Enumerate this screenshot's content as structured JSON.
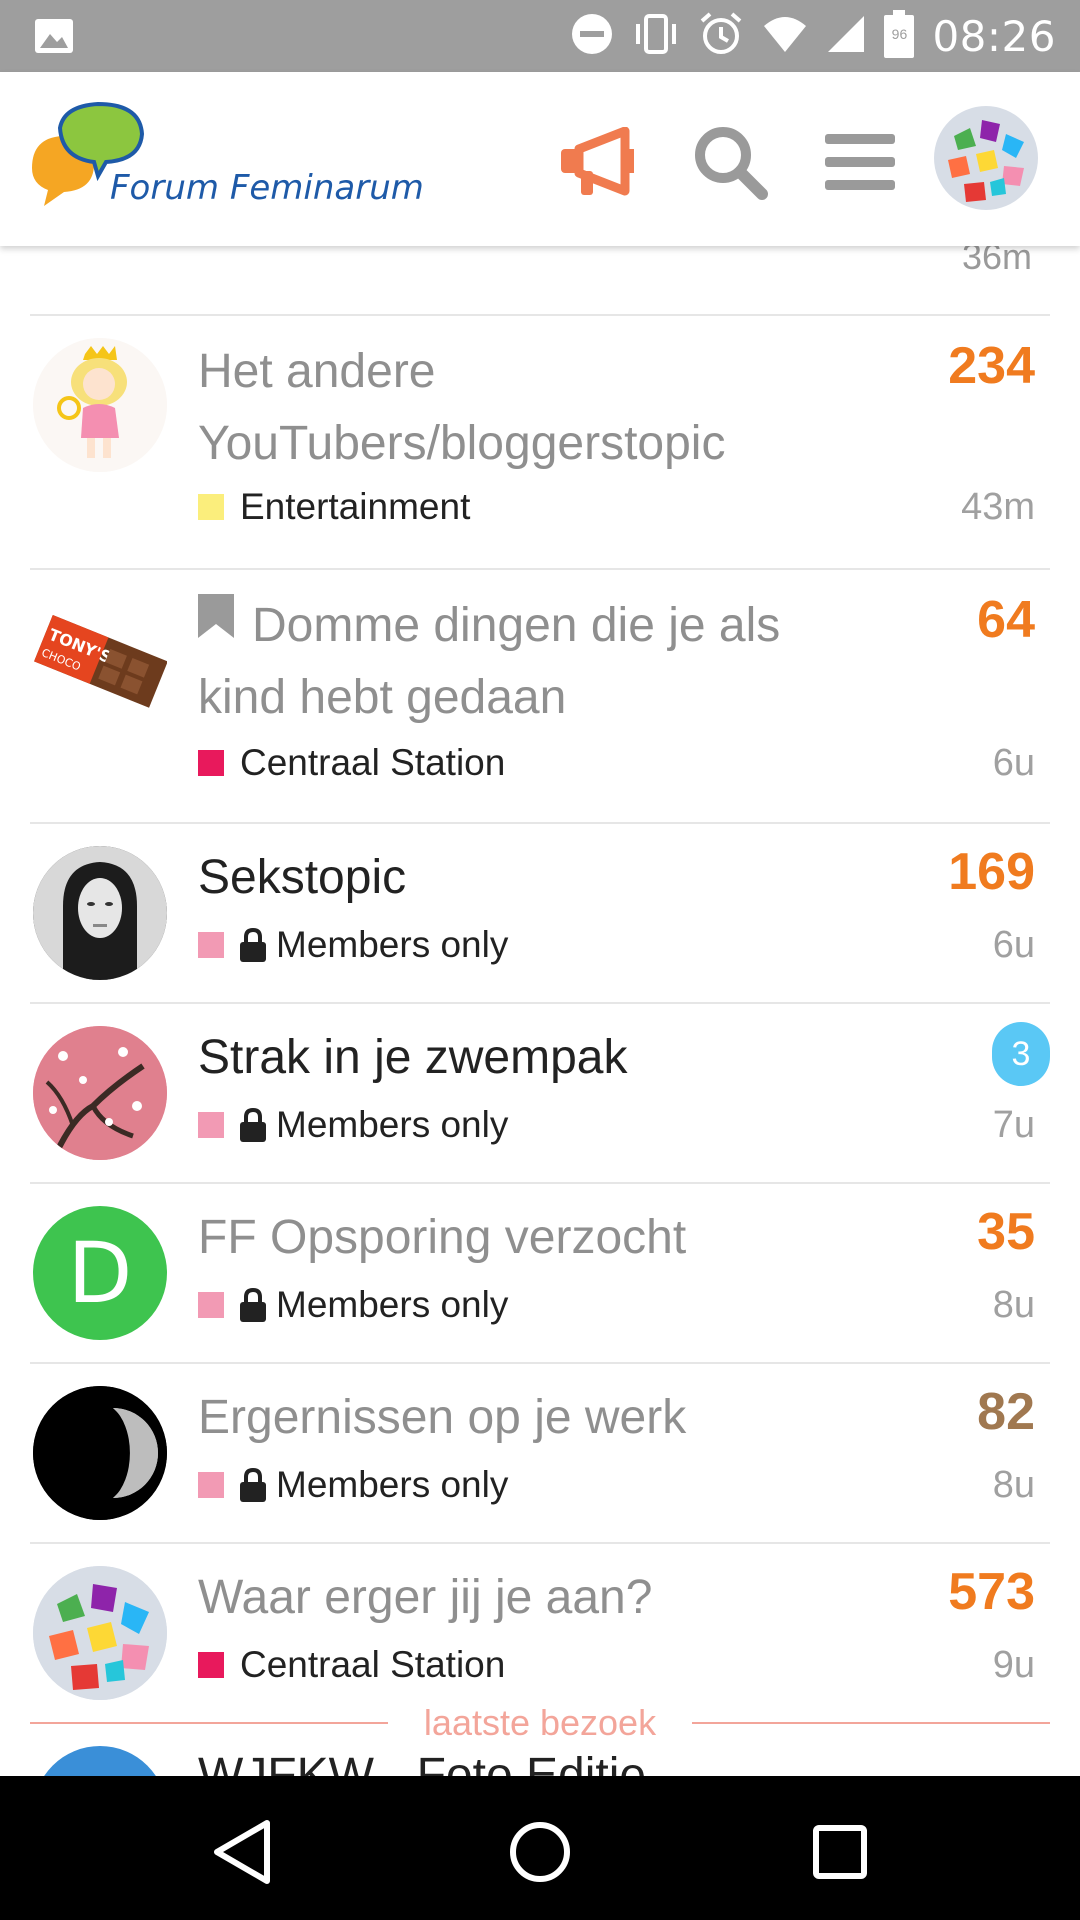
{
  "status_bar": {
    "time": "08:26",
    "battery": "96",
    "icons": [
      "image-icon",
      "dnd-icon",
      "vibrate-icon",
      "alarm-icon",
      "wifi-icon",
      "signal-icon",
      "battery-icon"
    ]
  },
  "header": {
    "logo_text": "Forum Feminarum",
    "icons": [
      "megaphone-icon",
      "search-icon",
      "menu-icon",
      "avatar"
    ],
    "accent_color": "#f07b4f"
  },
  "partial_top_time": "36m",
  "topics": [
    {
      "title": "Het andere YouTubers/bloggerstopic",
      "category": "Entertainment",
      "category_color": "#fbee7c",
      "members_only": false,
      "count": "234",
      "count_color": "#f07b1f",
      "time": "43m",
      "unread": false,
      "bookmarked": false
    },
    {
      "title": "Domme dingen die je als kind hebt gedaan",
      "category": "Centraal Station",
      "category_color": "#e8195c",
      "members_only": false,
      "count": "64",
      "count_color": "#f07b1f",
      "time": "6u",
      "unread": false,
      "bookmarked": true
    },
    {
      "title": "Sekstopic",
      "category": "Members only",
      "category_color": "#f29ab4",
      "members_only": true,
      "count": "169",
      "count_color": "#f07b1f",
      "time": "6u",
      "unread": true,
      "bookmarked": false
    },
    {
      "title": "Strak in je zwempak",
      "category": "Members only",
      "category_color": "#f29ab4",
      "members_only": true,
      "count": "",
      "badge": "3",
      "time": "7u",
      "unread": true,
      "bookmarked": false
    },
    {
      "title": "FF Opsporing verzocht",
      "category": "Members only",
      "category_color": "#f29ab4",
      "members_only": true,
      "count": "35",
      "count_color": "#f07b1f",
      "time": "8u",
      "unread": false,
      "bookmarked": false
    },
    {
      "title": "Ergernissen op je werk",
      "category": "Members only",
      "category_color": "#f29ab4",
      "members_only": true,
      "count": "82",
      "count_color": "#a07850",
      "time": "8u",
      "unread": false,
      "bookmarked": false
    },
    {
      "title": "Waar erger jij je aan?",
      "category": "Centraal Station",
      "category_color": "#e8195c",
      "members_only": false,
      "count": "573",
      "count_color": "#f07b1f",
      "time": "9u",
      "unread": false,
      "bookmarked": false
    }
  ],
  "avatar_letter": "D",
  "last_visit_label": "laatste bezoek",
  "next_topic_partial": "WJFKW - Foto Editie",
  "nav": [
    "back-icon",
    "home-icon",
    "recents-icon"
  ]
}
